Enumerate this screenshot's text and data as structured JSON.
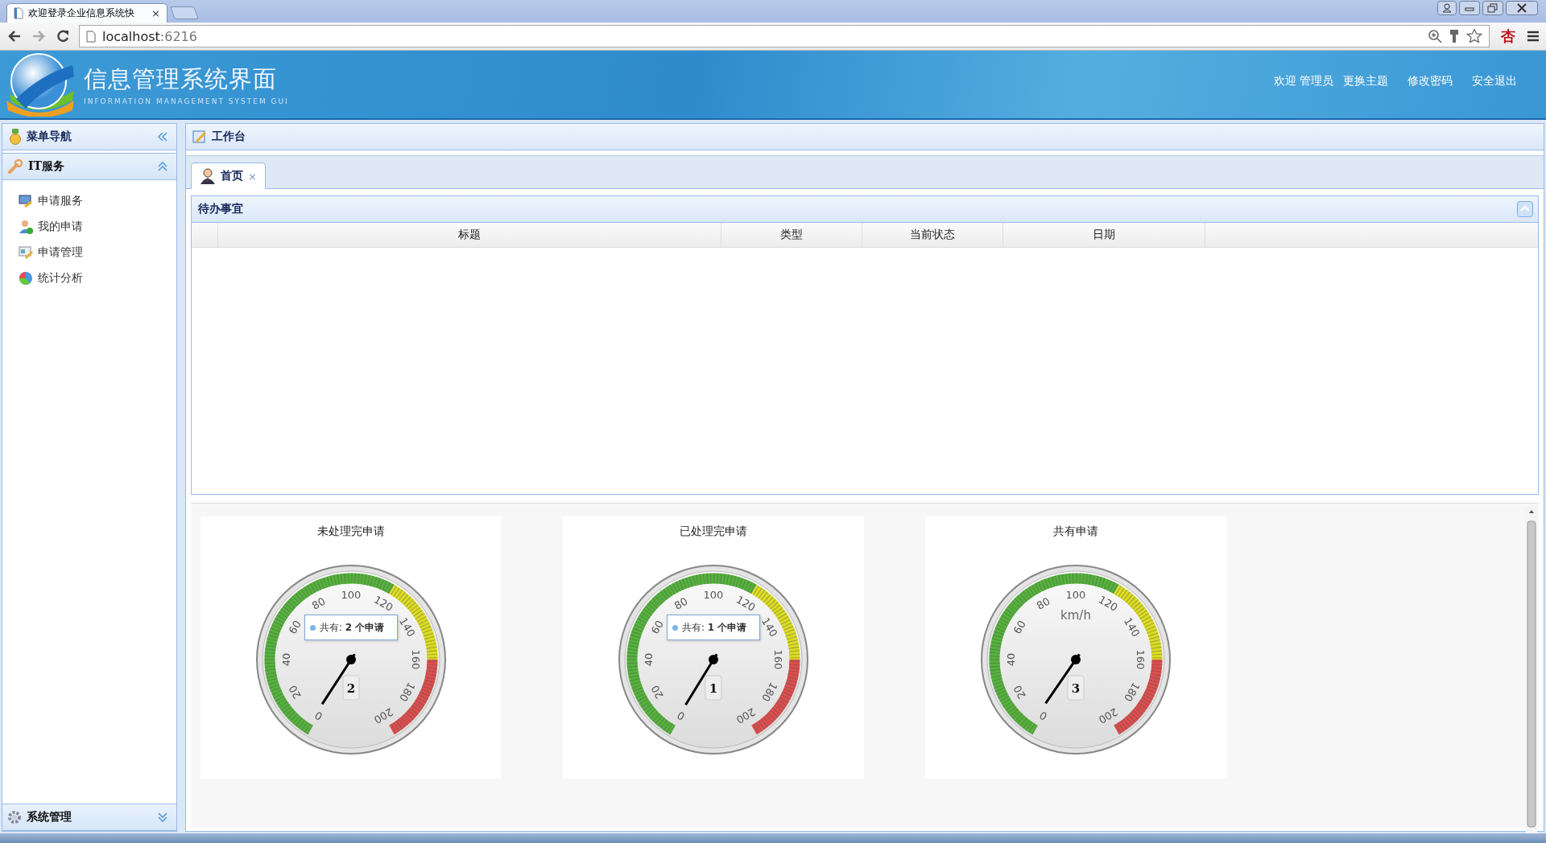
{
  "browser": {
    "tab": {
      "title": "欢迎登录企业信息系统快",
      "close": "×"
    },
    "address": {
      "host": "localhost",
      "port": ":6216"
    },
    "extension": "杏"
  },
  "header": {
    "title": "信息管理系统界面",
    "subtitle": "INFORMATION MANAGEMENT SYSTEM GUI",
    "links": [
      "欢迎 管理员",
      "更换主题",
      "修改密码",
      "安全退出"
    ]
  },
  "sidebar": {
    "title": "菜单导航",
    "sections": [
      {
        "label": "IT服务",
        "expanded": true,
        "items": [
          "申请服务",
          "我的申请",
          "申请管理",
          "统计分析"
        ]
      },
      {
        "label": "系统管理",
        "expanded": false
      }
    ]
  },
  "workspace": {
    "title": "工作台",
    "tabs": [
      {
        "label": "首页",
        "selected": true,
        "close": "×"
      }
    ],
    "panel": {
      "title": "待办事宜",
      "columns": [
        "标题",
        "类型",
        "当前状态",
        "日期"
      ]
    },
    "gauges": [
      {
        "title": "未处理完申请",
        "ticks": [
          "0",
          "20",
          "40",
          "60",
          "80",
          "100",
          "120",
          "140",
          "160",
          "180",
          "200"
        ],
        "value": "2",
        "tooltip": "共有: **2 个申请**"
      },
      {
        "title": "已处理完申请",
        "ticks": [
          "0",
          "20",
          "40",
          "60",
          "80",
          "100",
          "120",
          "140",
          "160",
          "180",
          "200"
        ],
        "value": "1",
        "tooltip": "共有: **1 个申请**"
      },
      {
        "title": "共有申请",
        "ticks": [
          "0",
          "20",
          "40",
          "60",
          "80",
          "100",
          "120",
          "140",
          "160",
          "180",
          "200"
        ],
        "unit": "km/h",
        "value": "3"
      }
    ]
  }
}
